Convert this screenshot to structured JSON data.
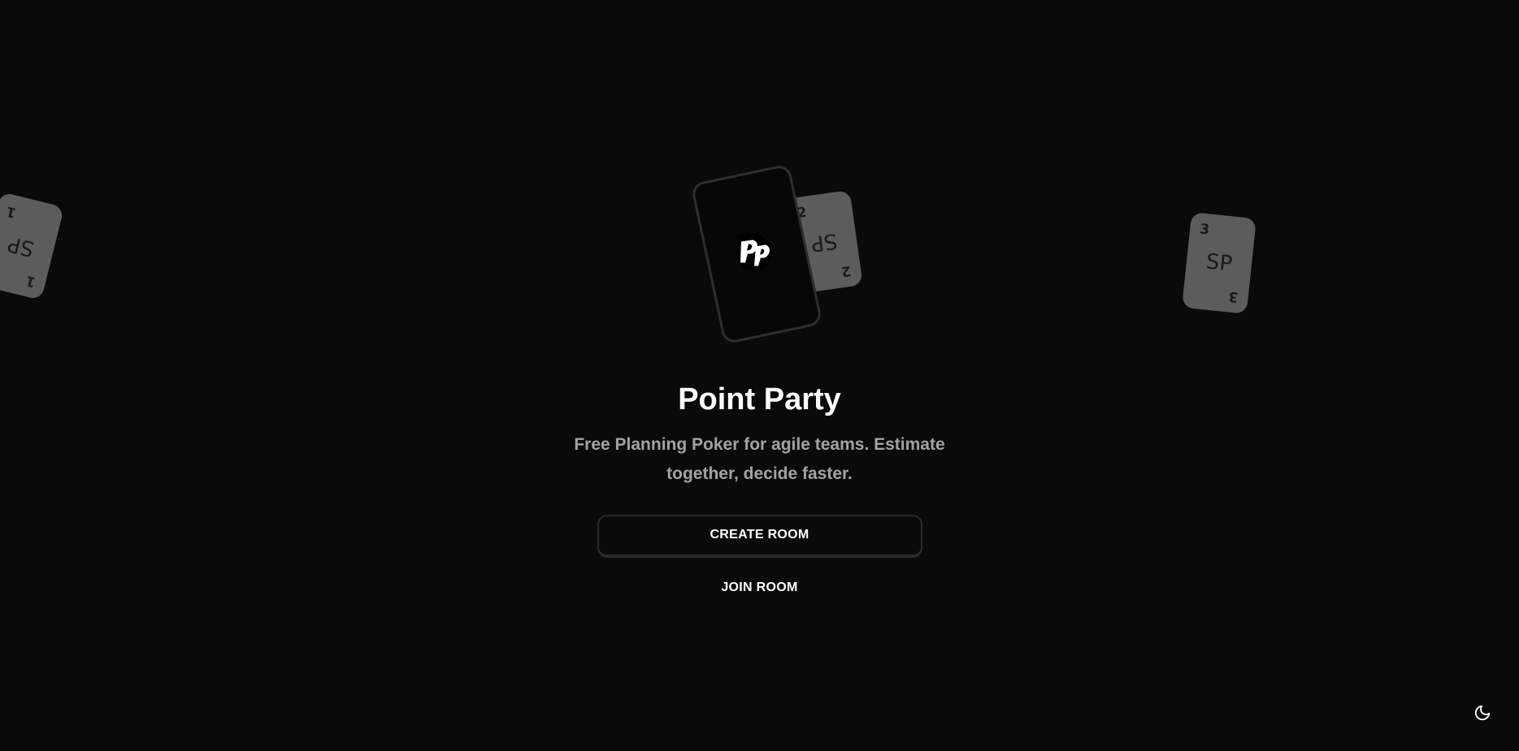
{
  "app": {
    "title": "Point Party",
    "subtitle": "Free Planning Poker for agile teams. Estimate together, decide faster."
  },
  "actions": {
    "create_room_label": "CREATE ROOM",
    "join_room_label": "JOIN ROOM"
  },
  "cards": [
    {
      "value": "1",
      "unit": "SP"
    },
    {
      "value": "2",
      "unit": "SP"
    },
    {
      "value": "3",
      "unit": "SP"
    }
  ],
  "icons": {
    "logo": "point-party-logo-icon",
    "theme_toggle": "moon-icon"
  },
  "colors": {
    "background": "#0a0a0a",
    "card": "#5c5c5c",
    "title": "#ffffff",
    "subtitle": "#a3a3a3"
  }
}
